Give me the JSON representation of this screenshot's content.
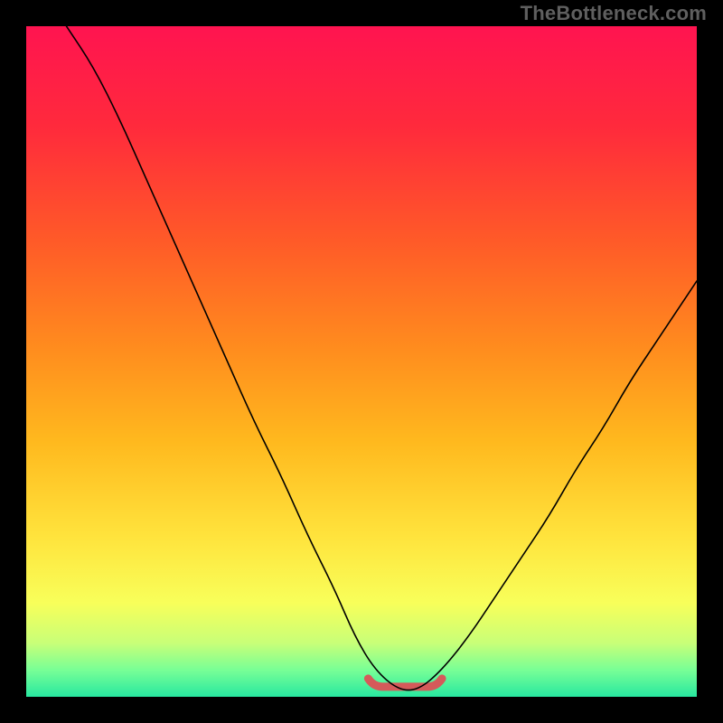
{
  "watermark": "TheBottleneck.com",
  "chart_data": {
    "type": "line",
    "title": "",
    "xlabel": "",
    "ylabel": "",
    "xlim": [
      0,
      100
    ],
    "ylim": [
      0,
      100
    ],
    "series": [
      {
        "name": "bottleneck-curve",
        "x": [
          6,
          10,
          14,
          18,
          22,
          26,
          30,
          34,
          38,
          42,
          46,
          49,
          52,
          55.5,
          58.5,
          62,
          66,
          70,
          74,
          78,
          82,
          86,
          90,
          94,
          98,
          100
        ],
        "values": [
          100,
          94,
          86,
          77,
          68,
          59,
          50,
          41,
          33,
          24,
          16,
          9,
          4,
          1,
          1,
          4,
          9,
          15,
          21,
          27,
          34,
          40,
          47,
          53,
          59,
          62
        ]
      }
    ],
    "annotations": [
      {
        "name": "flat-bottom-marker",
        "x_range": [
          51,
          62
        ],
        "y": 1.5,
        "color": "#d55a5a"
      }
    ],
    "background_gradient": {
      "stops": [
        {
          "offset": 0.0,
          "color": "#ff1450"
        },
        {
          "offset": 0.15,
          "color": "#ff2a3c"
        },
        {
          "offset": 0.32,
          "color": "#ff5a28"
        },
        {
          "offset": 0.48,
          "color": "#ff8c1e"
        },
        {
          "offset": 0.62,
          "color": "#ffb91e"
        },
        {
          "offset": 0.76,
          "color": "#ffe33c"
        },
        {
          "offset": 0.86,
          "color": "#f8ff5a"
        },
        {
          "offset": 0.92,
          "color": "#c8ff78"
        },
        {
          "offset": 0.96,
          "color": "#78ff96"
        },
        {
          "offset": 1.0,
          "color": "#28e8a0"
        }
      ]
    }
  }
}
